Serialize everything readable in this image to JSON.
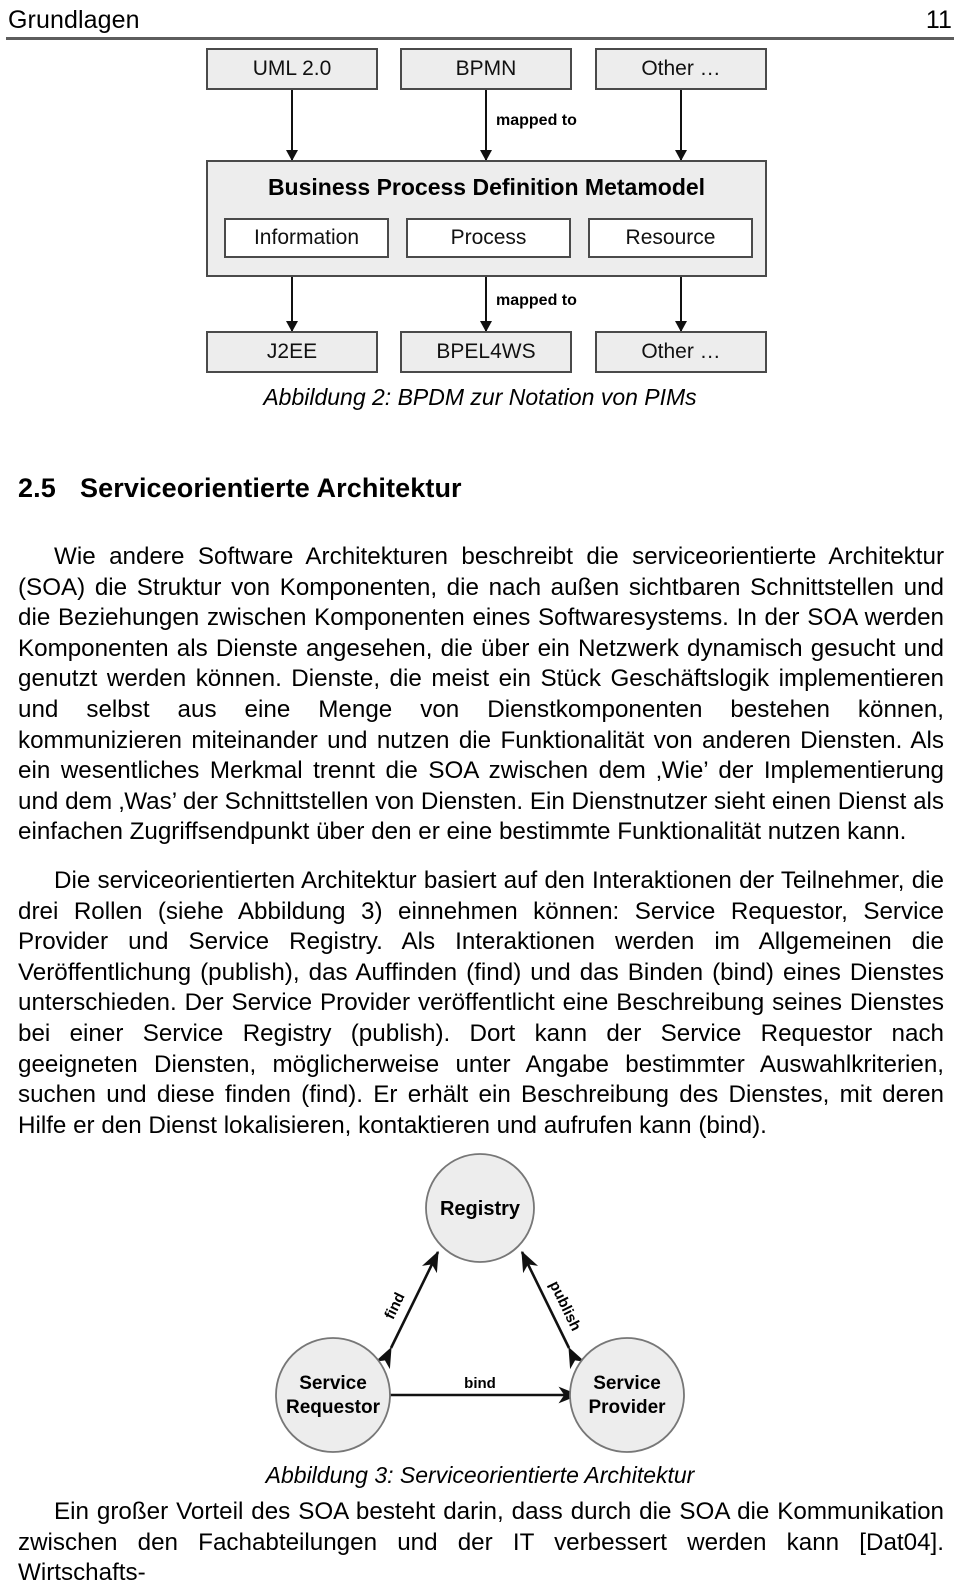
{
  "header": {
    "title": "Grundlagen",
    "page_number": "11"
  },
  "figure2": {
    "top_row": [
      "UML 2.0",
      "BPMN",
      "Other …"
    ],
    "metamodel_title": "Business Process Definition Metamodel",
    "metamodel_parts": [
      "Information",
      "Process",
      "Resource"
    ],
    "bottom_row": [
      "J2EE",
      "BPEL4WS",
      "Other …"
    ],
    "arrow_label_top": "mapped to",
    "arrow_label_bottom": "mapped to",
    "caption": "Abbildung 2: BPDM zur Notation von PIMs",
    "box_fill": "#ededed",
    "box_border": "#4a4a4a"
  },
  "section": {
    "number": "2.5",
    "title": "Serviceorientierte Architektur"
  },
  "body": {
    "paragraph1": "Wie andere Software Architekturen beschreibt die serviceorientierte Architektur (SOA) die Struktur von Komponenten, die nach außen sichtbaren Schnittstellen und die Beziehungen zwischen Komponenten eines Softwaresystems. In der SOA werden Komponenten als Dienste angesehen, die über ein Netzwerk dynamisch gesucht und genutzt werden können. Dienste, die meist ein Stück Geschäftslogik implementieren und selbst aus eine Menge von Dienstkomponenten bestehen können, kommunizieren miteinander und nutzen die Funktionalität von anderen Diensten. Als ein wesentliches Merkmal trennt die SOA zwischen dem ‚Wie’ der Implementierung und dem ‚Was’ der Schnittstellen von Diensten. Ein Dienstnutzer sieht einen Dienst als einfachen Zugriffsendpunkt über den er eine bestimmte Funktionalität nutzen kann.",
    "paragraph2": "Die serviceorientierten Architektur basiert auf den Interaktionen der Teilnehmer, die drei Rollen (siehe Abbildung 3) einnehmen können: Service Requestor, Service Provider und Service Registry. Als Interaktionen werden im Allgemeinen die Veröffentlichung (publish), das Auffinden (find) und das Binden (bind) eines Dienstes unterschieden. Der Service Provider veröffentlicht eine Beschreibung seines Dienstes bei einer Service Registry (publish). Dort kann der Service Requestor nach geeigneten Diensten, möglicherweise unter Angabe bestimmter Auswahlkriterien, suchen und diese finden (find). Er erhält ein Beschreibung des Dienstes, mit deren Hilfe er den Dienst lokalisieren, kontaktieren und aufrufen kann (bind).",
    "paragraph3": "Ein großer Vorteil des SOA besteht darin, dass durch die SOA die Kommunikation zwischen den Fachabteilungen und der IT verbessert werden kann [Dat04]. Wirtschafts-"
  },
  "figure3": {
    "nodes": {
      "registry": "Registry",
      "requestor_line1": "Service",
      "requestor_line2": "Requestor",
      "provider_line1": "Service",
      "provider_line2": "Provider"
    },
    "edges": {
      "find": "find",
      "publish": "publish",
      "bind": "bind"
    },
    "caption": "Abbildung 3: Serviceorientierte Architektur",
    "circle_fill": "#ededed",
    "circle_stroke": "#777777"
  }
}
